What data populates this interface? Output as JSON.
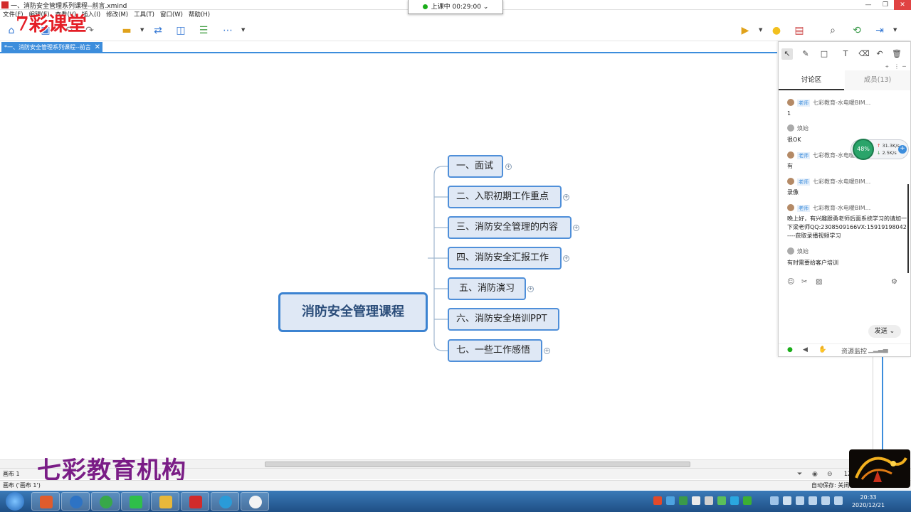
{
  "window": {
    "title": "一、消防安全管理系列课程--前言.xmind",
    "min": "—",
    "max": "❐",
    "close": "✕"
  },
  "session": {
    "status": "上课中 00:29:00"
  },
  "menu": [
    "文件(F)",
    "编辑(E)",
    "查看(V)",
    "插入(I)",
    "修改(M)",
    "工具(T)",
    "窗口(W)",
    "帮助(H)"
  ],
  "brand": {
    "logo_text": "7彩课堂",
    "footer_text": "七彩教育机构",
    "colors": {
      "logo": "#e41e26",
      "footer": "#7a1d86"
    }
  },
  "doc_tab": {
    "label": "*一、消防安全管理系列课程--前言",
    "close": "✕"
  },
  "mindmap": {
    "central": "消防安全管理课程",
    "branches": [
      "一、面试",
      "二、入职初期工作重点",
      "三、消防安全管理的内容",
      "四、消防安全汇报工作",
      "五、消防演习",
      "六、消防安全培训PPT",
      "七、一些工作感悟"
    ],
    "expand_symbol": "+"
  },
  "chat": {
    "tabs": {
      "discussion": "讨论区",
      "members": "成员(13)"
    },
    "messages": [
      {
        "sender": "七彩教育-水电暖BIM...",
        "role": "老师",
        "text": "1"
      },
      {
        "sender": "焕始",
        "role": "",
        "text": "很OK"
      },
      {
        "sender": "七彩教育-水电暖BIM...",
        "role": "老师",
        "text": "有"
      },
      {
        "sender": "七彩教育-水电暖BIM...",
        "role": "老师",
        "text": "录像"
      },
      {
        "sender": "七彩教育-水电暖BIM...",
        "role": "老师",
        "text": "晚上好，有兴趣跟勇老师后面系统学习的请加一下梁老师QQ:2308509166VX:15919198042----获取录播视频学习"
      },
      {
        "sender": "焕始",
        "role": "",
        "text": "有时需要给客户培训"
      }
    ],
    "send_label": "发送",
    "resource_monitor": "资源监控"
  },
  "network": {
    "percent": "48%",
    "up": "31.3K/s",
    "down": "2.5K/s"
  },
  "sheetbar": {
    "sheet": "画布 1",
    "zoom": "120%"
  },
  "statusbar": {
    "left": "画布 ('画布 1')",
    "autosave": "自动保存: 关闭"
  },
  "clock": {
    "time": "20:33",
    "date": "2020/12/21"
  }
}
